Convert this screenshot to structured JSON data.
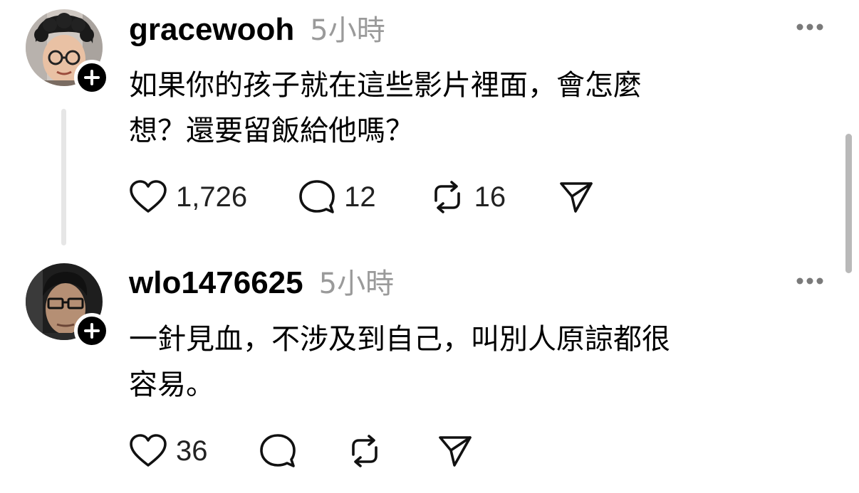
{
  "posts": [
    {
      "username": "gracewooh",
      "time": "5小時",
      "text_lines": [
        "如果你的孩子就在這些影片裡面，會怎麼",
        "想？還要留飯給他嗎？"
      ],
      "likes": "1,726",
      "replies": "12",
      "reposts": "16",
      "avatar_icon": "avatar-curly-hair-glasses"
    },
    {
      "username": "wlo1476625",
      "time": "5小時",
      "text_lines": [
        "一針見血，不涉及到自己，叫別人原諒都很",
        "容易。"
      ],
      "likes": "36",
      "replies": "",
      "reposts": "",
      "avatar_icon": "avatar-dark-glasses"
    }
  ],
  "icons": {
    "like": "heart-icon",
    "reply": "comment-bubble-icon",
    "repost": "repost-arrows-icon",
    "share": "send-paper-plane-icon",
    "more": "more-dots-icon",
    "follow": "plus-icon"
  },
  "colors": {
    "text": "#000000",
    "muted": "#9a9a9a",
    "thread_line": "#e6e6e6",
    "scrollbar": "#b9b9b9"
  }
}
